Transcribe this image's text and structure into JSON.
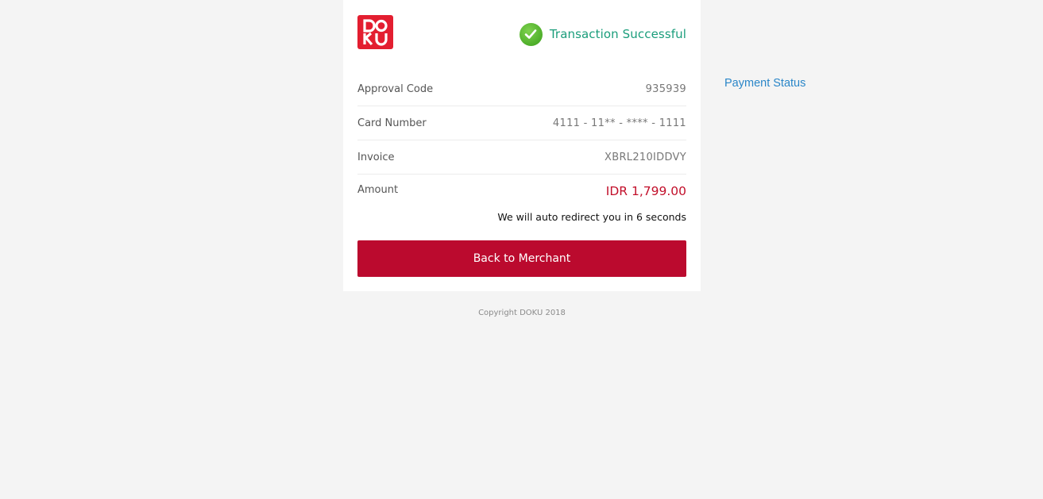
{
  "brand": {
    "logo_text": "DOKU",
    "logo_icon": "doku-logo",
    "color": "#e31e30"
  },
  "status": {
    "icon": "check-circle-icon",
    "text": "Transaction Successful",
    "color": "#1a9d7b"
  },
  "details": [
    {
      "label": "Approval Code",
      "value": "935939"
    },
    {
      "label": "Card Number",
      "value": "4111 - 11** - **** - 1111"
    },
    {
      "label": "Invoice",
      "value": "XBRL210IDDVY"
    }
  ],
  "amount": {
    "label": "Amount",
    "value": "IDR 1,799.00",
    "color": "#c2102b"
  },
  "redirect_text": "We will auto redirect you in 6 seconds",
  "back_button_label": "Back to Merchant",
  "back_button_color": "#bb0a2e",
  "copyright": "Copyright DOKU 2018",
  "payment_status_link": "Payment Status"
}
